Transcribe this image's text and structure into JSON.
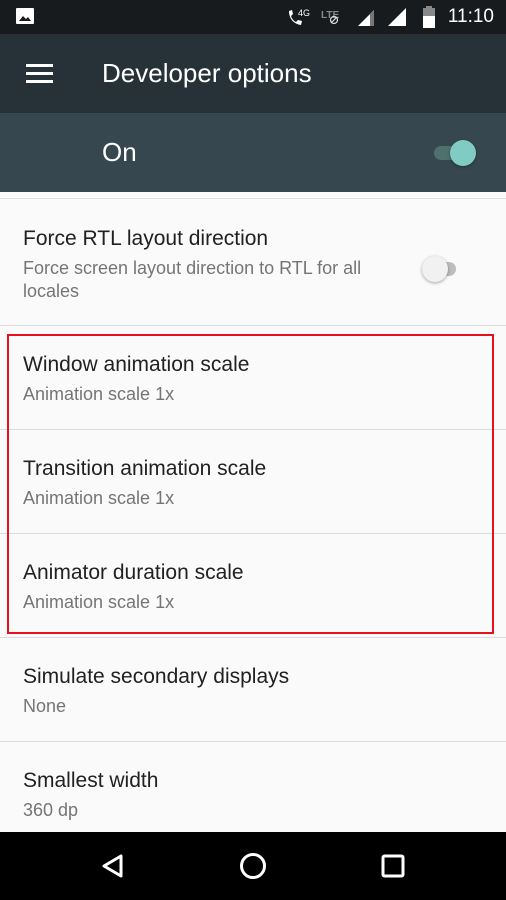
{
  "status_bar": {
    "left_icons": [
      "image-notification-icon"
    ],
    "right_icons": [
      "wifi-calling-4g-icon",
      "lte-disabled-icon",
      "signal-sim1-icon",
      "signal-sim2-icon",
      "battery-icon"
    ],
    "call_label": "4G",
    "lte_label": "LTE",
    "time": "11:10"
  },
  "app_bar": {
    "menu_icon": "hamburger-menu-icon",
    "title": "Developer options"
  },
  "master_switch": {
    "label": "On",
    "checked": true,
    "accent_color": "#80cbc4"
  },
  "settings": [
    {
      "title": "Force RTL layout direction",
      "summary": "Force screen layout direction to RTL for all locales",
      "has_switch": true,
      "checked": false
    },
    {
      "title": "Window animation scale",
      "summary": "Animation scale 1x"
    },
    {
      "title": "Transition animation scale",
      "summary": "Animation scale 1x"
    },
    {
      "title": "Animator duration scale",
      "summary": "Animation scale 1x"
    },
    {
      "title": "Simulate secondary displays",
      "summary": "None"
    },
    {
      "title": "Smallest width",
      "summary": "360 dp"
    }
  ],
  "annotation": {
    "highlight_color": "#e8101c",
    "highlighted_items": [
      "Window animation scale",
      "Transition animation scale",
      "Animator duration scale"
    ]
  },
  "nav_bar": {
    "buttons": [
      "back-icon",
      "home-icon",
      "recents-icon"
    ]
  }
}
